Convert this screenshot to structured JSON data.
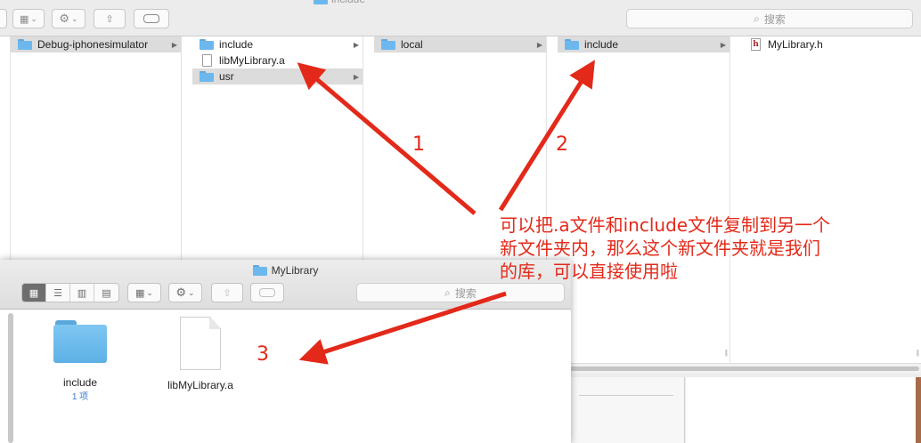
{
  "back_window": {
    "title": "include",
    "search_placeholder": "搜索",
    "columns": [
      {
        "items": [
          {
            "label": "Debug-iphonesimulator",
            "icon": "folder-icon",
            "selected": true,
            "arrow": true
          }
        ]
      },
      {
        "items": [
          {
            "label": "include",
            "icon": "folder-icon",
            "selected": false,
            "arrow": true
          },
          {
            "label": "libMyLibrary.a",
            "icon": "file-icon",
            "selected": false,
            "arrow": false
          },
          {
            "label": "usr",
            "icon": "folder-icon",
            "selected": true,
            "arrow": true
          }
        ]
      },
      {
        "items": [
          {
            "label": "local",
            "icon": "folder-icon",
            "selected": true,
            "arrow": true
          }
        ]
      },
      {
        "items": [
          {
            "label": "include",
            "icon": "folder-icon",
            "selected": true,
            "arrow": true
          }
        ]
      },
      {
        "items": [
          {
            "label": "MyLibrary.h",
            "icon": "header-file-icon",
            "selected": false,
            "arrow": false
          }
        ]
      }
    ]
  },
  "front_window": {
    "title": "MyLibrary",
    "search_placeholder": "搜索",
    "items": [
      {
        "label": "include",
        "sublabel": "1 项",
        "icon": "folder-icon"
      },
      {
        "label": "libMyLibrary.a",
        "sublabel": "",
        "icon": "file-icon"
      }
    ]
  },
  "annotations": {
    "color": "#e3291a",
    "numbers": [
      "1",
      "2",
      "3"
    ],
    "note_lines": [
      "可以把.a文件和include文件复制到另一个",
      "新文件夹内，那么这个新文件夹就是我们",
      "的库，可以直接使用啦"
    ]
  },
  "glyphs": {
    "arrow": "▶",
    "search": "🔍",
    "gear": "⚙",
    "chevron": "⌄",
    "share": "⇧"
  }
}
